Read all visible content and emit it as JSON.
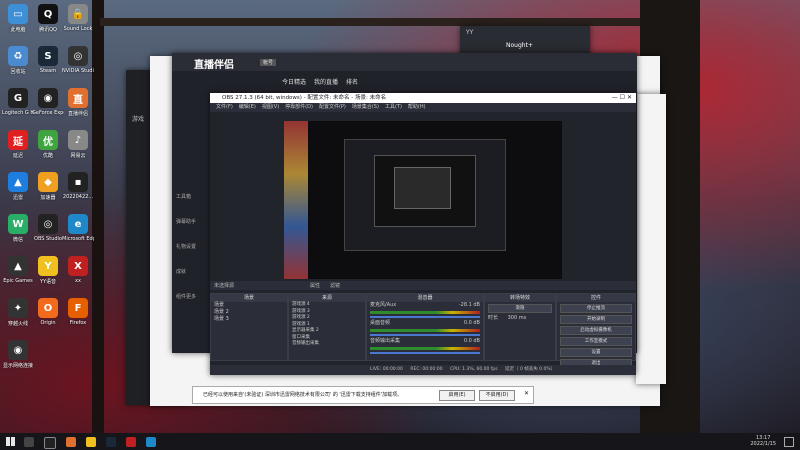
{
  "desktop_icons": [
    {
      "label": "此电脑",
      "color": "#3d8fd6",
      "glyph": "▭"
    },
    {
      "label": "腾讯QQ",
      "color": "#111",
      "glyph": "Q"
    },
    {
      "label": "Sound Lock",
      "color": "#888",
      "glyph": "🔒"
    },
    {
      "label": "回收站",
      "color": "#4a8ad0",
      "glyph": "♻"
    },
    {
      "label": "Steam",
      "color": "#1b2838",
      "glyph": "S"
    },
    {
      "label": "NVIDIA Studio",
      "color": "#333",
      "glyph": "◎"
    },
    {
      "label": "Logitech G HUB",
      "color": "#222",
      "glyph": "G"
    },
    {
      "label": "GeForce Experience",
      "color": "#222",
      "glyph": "◉"
    },
    {
      "label": "直播伴侣",
      "color": "#e07030",
      "glyph": "直"
    },
    {
      "label": "延迟",
      "color": "#e02020",
      "glyph": "延"
    },
    {
      "label": "优酷",
      "color": "#3fa33f",
      "glyph": "优"
    },
    {
      "label": "网易云",
      "color": "#888",
      "glyph": "♪"
    },
    {
      "label": "迅雷",
      "color": "#1e7ee0",
      "glyph": "▲"
    },
    {
      "label": "加速器",
      "color": "#f0a020",
      "glyph": "◆"
    },
    {
      "label": "20220422...",
      "color": "#222",
      "glyph": "▪"
    },
    {
      "label": "微信",
      "color": "#2aae67",
      "glyph": "W"
    },
    {
      "label": "OBS Studio",
      "color": "#222",
      "glyph": "◎"
    },
    {
      "label": "Microsoft Edge",
      "color": "#1e88c8",
      "glyph": "e"
    },
    {
      "label": "Epic Games",
      "color": "#333",
      "glyph": "▲"
    },
    {
      "label": "YY语音",
      "color": "#f0c020",
      "glyph": "Y"
    },
    {
      "label": "xx",
      "color": "#c02020",
      "glyph": "X"
    },
    {
      "label": "穿越火线",
      "color": "#333",
      "glyph": "✦"
    },
    {
      "label": "Origin",
      "color": "#f26a1b",
      "glyph": "O"
    },
    {
      "label": "Firefox",
      "color": "#e66000",
      "glyph": "F"
    },
    {
      "label": "显示网络连接",
      "color": "#333",
      "glyph": "◉"
    }
  ],
  "yy_window": {
    "title": "YY",
    "user": "Nought+"
  },
  "store_window": {
    "title": "商店",
    "search": "游戏"
  },
  "live_window": {
    "app_name": "直播伴侣",
    "badge": "帐号",
    "tabs": [
      "今日精选",
      "我的直播",
      "排名"
    ],
    "sidebar": [
      "工具箱",
      "弹幕助手",
      "礼物设置",
      "成就",
      "组件更多"
    ]
  },
  "obs": {
    "title": "OBS 27.1.3 (64 bit, windows) - 配置文件: 未命名 - 场景: 未命名",
    "menu": [
      "文件(F)",
      "编辑(E)",
      "视图(V)",
      "停靠部件(D)",
      "配置文件(P)",
      "场景集合(S)",
      "工具(T)",
      "帮助(H)"
    ],
    "no_source": "未选择源",
    "props_label": "属性",
    "filter_label": "滤镜",
    "panels": {
      "scenes": {
        "header": "场景",
        "items": [
          "场景",
          "场景 2",
          "场景 3"
        ]
      },
      "sources": {
        "header": "来源",
        "items": [
          "游戏源 4",
          "游戏源 3",
          "游戏源 2",
          "游戏源 1",
          "显示器采集 2",
          "窗口采集",
          "音频输出采集"
        ]
      },
      "mixer": {
        "header": "混音器",
        "channels": [
          {
            "name": "麦克风/Aux",
            "db": "-28.1 dB"
          },
          {
            "name": "桌面音频",
            "db": "0.0 dB"
          },
          {
            "name": "音频输出采集",
            "db": "0.0 dB"
          }
        ]
      },
      "transition": {
        "header": "转场特效",
        "mode": "渐隐",
        "duration_label": "时长",
        "duration": "300 ms"
      },
      "controls": {
        "header": "控件",
        "buttons": [
          "停止推流",
          "开始录制",
          "启动虚拟摄像机",
          "工作室模式",
          "设置",
          "退出"
        ]
      }
    },
    "status": {
      "live": "LIVE: 00:00:00",
      "rec": "REC: 00:00:00",
      "cpu": "CPU: 1.3%, 60.00 fps",
      "bitrate": "延迟（ 0 帧丢失 0.0%）"
    }
  },
  "notification": {
    "text": "已经可以使用来自'(未验证) 深圳市迅雷网络技术有限公司' 的 '迅雷下载支持组件'加载项。",
    "enable": "启用(E)",
    "disable": "不启用(D)"
  },
  "taskbar": {
    "time": "13:17",
    "date": "2022/1/15"
  }
}
